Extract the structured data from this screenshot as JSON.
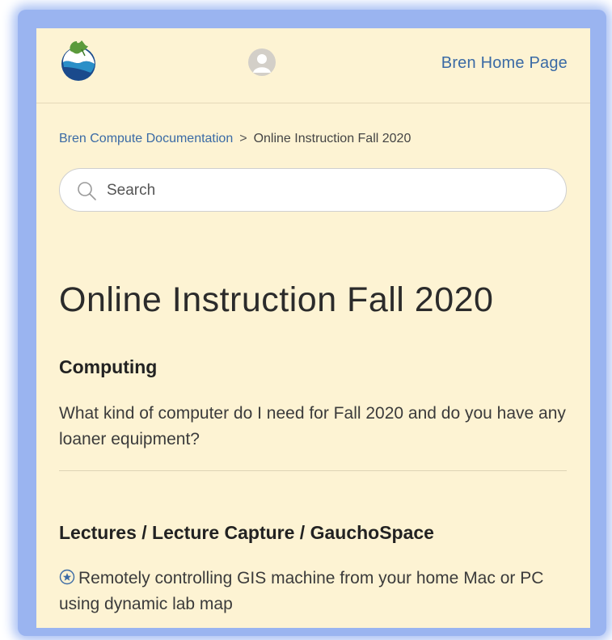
{
  "header": {
    "home_link": "Bren Home Page"
  },
  "breadcrumb": {
    "parent": "Bren Compute Documentation",
    "separator": ">",
    "current": "Online Instruction Fall 2020"
  },
  "search": {
    "placeholder": "Search"
  },
  "page": {
    "title": "Online Instruction Fall 2020"
  },
  "sections": [
    {
      "title": "Computing",
      "articles": [
        {
          "label": "What kind of computer do I need for Fall 2020 and do you have any loaner equipment?"
        }
      ]
    },
    {
      "title": "Lectures / Lecture Capture / GauchoSpace",
      "articles": [
        {
          "label": "Remotely controlling GIS machine from your home Mac or PC using dynamic lab map",
          "promoted": true
        }
      ]
    }
  ],
  "icons": {
    "logo": "bren-logo-icon",
    "avatar": "user-avatar-icon",
    "search": "search-icon",
    "promoted": "star-circle-icon"
  },
  "colors": {
    "panel_background": "#fdf3d3",
    "link_blue": "#3a6aa5",
    "frame_glow": "#9ab4f0"
  }
}
